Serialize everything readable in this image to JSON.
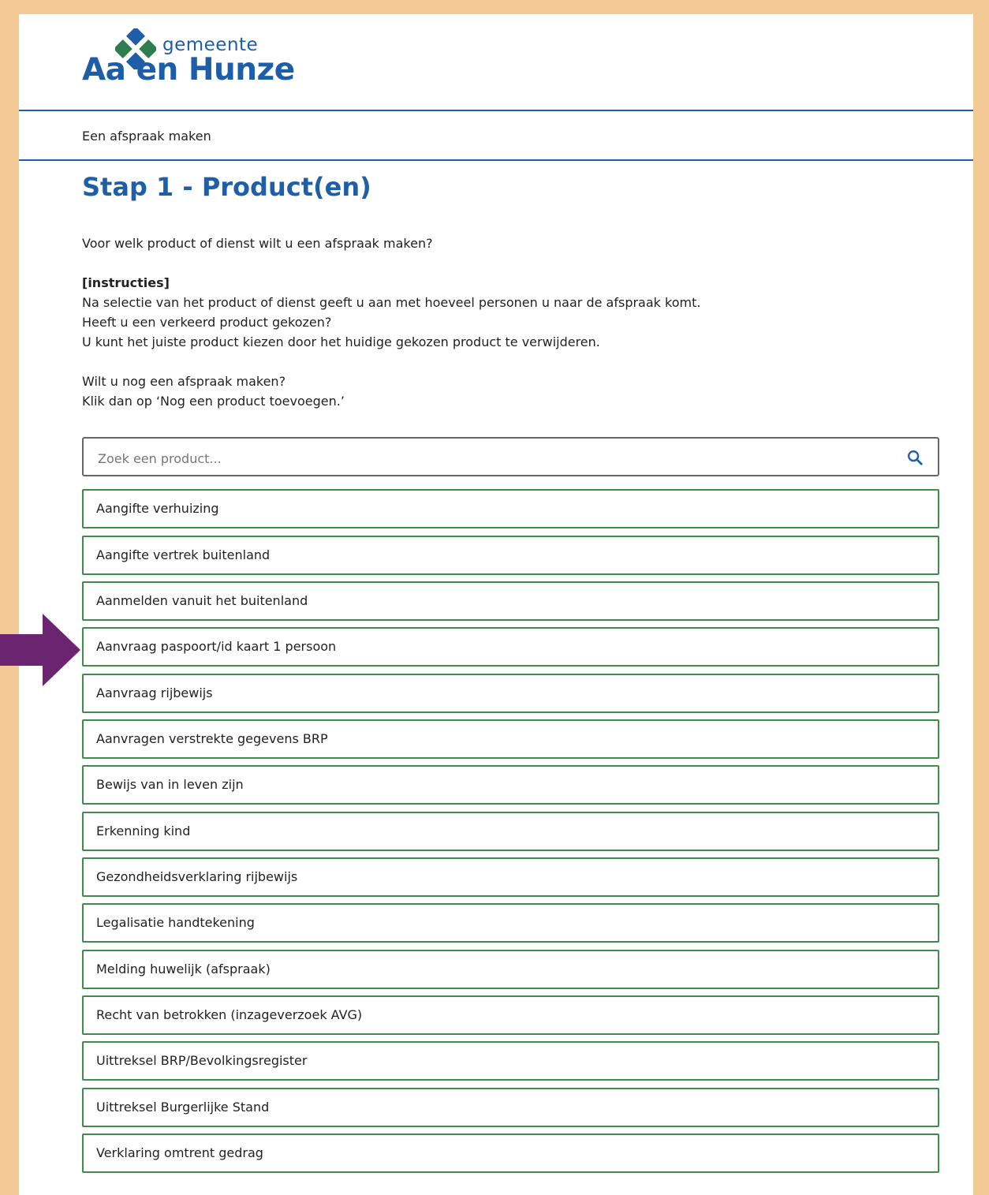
{
  "logo": {
    "line1": "gemeente",
    "line2": "Aa en Hunze"
  },
  "breadcrumb": "Een afspraak maken",
  "title": "Stap 1 - Product(en)",
  "intro": {
    "question": "Voor welk product of dienst wilt u een afspraak maken?",
    "instructions_label": "[instructies]",
    "instruction_lines": [
      "Na selectie van het product of dienst geeft u aan met hoeveel personen u naar de afspraak komt.",
      "Heeft u een verkeerd product gekozen?",
      "U kunt het juiste product kiezen door het huidige gekozen product te verwijderen."
    ],
    "again_lines": [
      "Wilt u nog een afspraak maken?",
      "Klik dan op ‘Nog een product toevoegen.’"
    ]
  },
  "search": {
    "placeholder": "Zoek een product...",
    "icon": "search-icon"
  },
  "products": [
    "Aangifte verhuizing",
    "Aangifte vertrek buitenland",
    "Aanmelden vanuit het buitenland",
    "Aanvraag paspoort/id kaart 1 persoon",
    "Aanvraag rijbewijs",
    "Aanvragen verstrekte gegevens BRP",
    "Bewijs van in leven zijn",
    "Erkenning kind",
    "Gezondheidsverklaring rijbewijs",
    "Legalisatie handtekening",
    "Melding huwelijk (afspraak)",
    "Recht van betrokken (inzageverzoek AVG)",
    "Uittreksel BRP/Bevolkingsregister",
    "Uittreksel Burgerlijke Stand",
    "Verklaring omtrent gedrag"
  ],
  "highlighted_product_index": 3,
  "colors": {
    "frame": "#f3c995",
    "brand_blue": "#1f5fa8",
    "logo_green": "#2e7d4f",
    "product_border": "#3f8c4a",
    "arrow": "#6b2470"
  }
}
